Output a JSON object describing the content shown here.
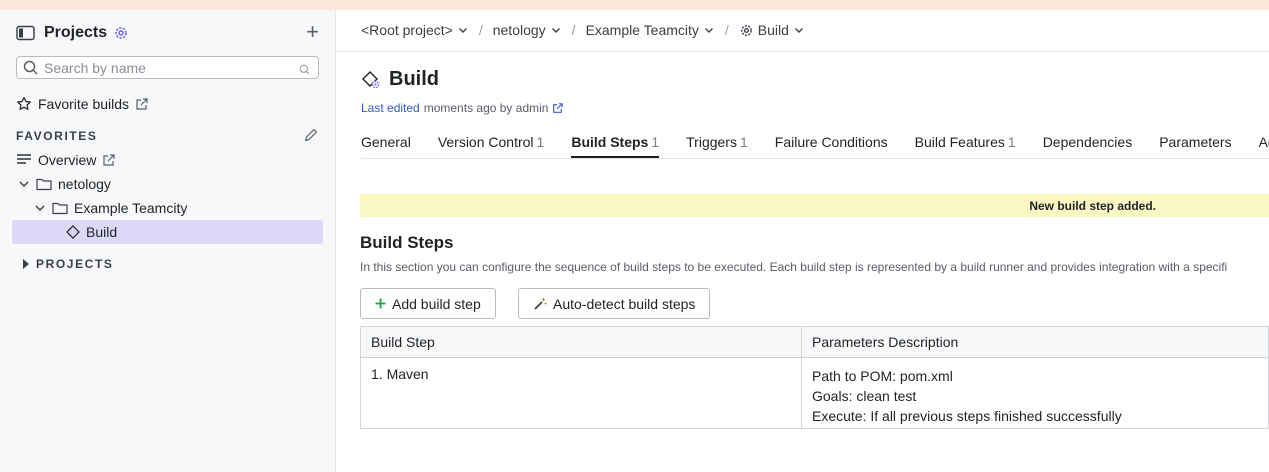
{
  "sidebar": {
    "title": "Projects",
    "add_symbol": "+",
    "search_placeholder": "Search by name",
    "favorite_builds": "Favorite builds",
    "favorites_title": "FAVORITES",
    "tree": [
      {
        "label": "Overview"
      },
      {
        "label": "netology"
      },
      {
        "label": "Example Teamcity"
      },
      {
        "label": "Build"
      }
    ],
    "projects_title": "PROJECTS"
  },
  "breadcrumb": {
    "root": "<Root project>",
    "project": "netology",
    "subproject": "Example Teamcity",
    "build": "Build"
  },
  "page": {
    "title": "Build",
    "last_edited_link": "Last edited",
    "last_edited_rest": "moments ago by admin"
  },
  "tabs": [
    {
      "label": "General",
      "count": ""
    },
    {
      "label": "Version Control",
      "count": "1"
    },
    {
      "label": "Build Steps",
      "count": "1"
    },
    {
      "label": "Triggers",
      "count": "1"
    },
    {
      "label": "Failure Conditions",
      "count": ""
    },
    {
      "label": "Build Features",
      "count": "1"
    },
    {
      "label": "Dependencies",
      "count": ""
    },
    {
      "label": "Parameters",
      "count": ""
    },
    {
      "label": "Agent",
      "count": ""
    }
  ],
  "notice": "New build step added.",
  "build_steps": {
    "title": "Build Steps",
    "description": "In this section you can configure the sequence of build steps to be executed. Each build step is represented by a build runner and provides integration with a specifi",
    "add_button": "Add build step",
    "autodetect_button": "Auto-detect build steps",
    "columns": [
      "Build Step",
      "Parameters Description"
    ],
    "rows": [
      {
        "step": "1. Maven",
        "params": [
          "Path to POM: pom.xml",
          "Goals: clean test",
          "Execute: If all previous steps finished successfully"
        ]
      }
    ]
  },
  "colors": {
    "accent": "#6b5ce7",
    "selected_bg": "#dcd9f8",
    "notice_bg": "#fbf8c3",
    "link": "#3659c9",
    "plus_green": "#22a34a"
  }
}
